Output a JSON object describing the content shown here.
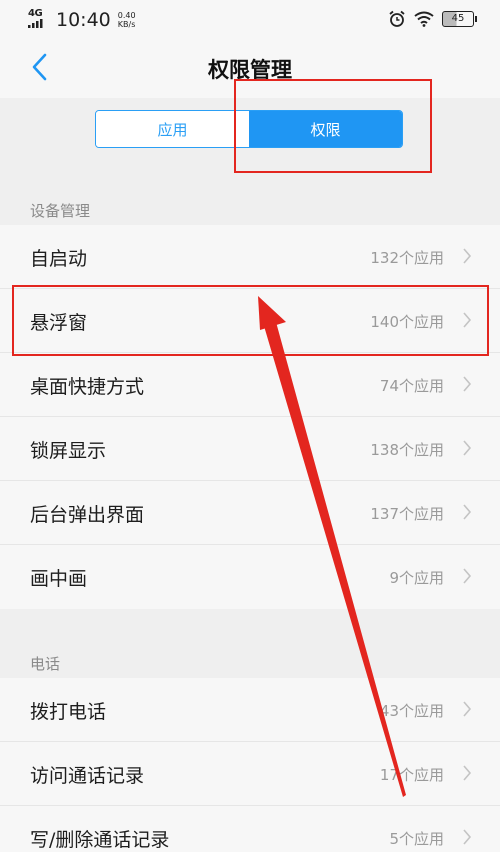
{
  "status": {
    "network": "4G",
    "time": "10:40",
    "speed_value": "0.40",
    "speed_unit": "KB/s",
    "battery": "45"
  },
  "header": {
    "title": "权限管理",
    "back_icon": "chevron-left-icon"
  },
  "tabs": [
    {
      "label": "应用",
      "selected": false
    },
    {
      "label": "权限",
      "selected": true
    }
  ],
  "sections": [
    {
      "title": "设备管理",
      "items": [
        {
          "label": "自启动",
          "value": "132个应用"
        },
        {
          "label": "悬浮窗",
          "value": "140个应用"
        },
        {
          "label": "桌面快捷方式",
          "value": "74个应用"
        },
        {
          "label": "锁屏显示",
          "value": "138个应用"
        },
        {
          "label": "后台弹出界面",
          "value": "137个应用"
        },
        {
          "label": "画中画",
          "value": "9个应用"
        }
      ]
    },
    {
      "title": "电话",
      "items": [
        {
          "label": "拨打电话",
          "value": "43个应用"
        },
        {
          "label": "访问通话记录",
          "value": "17个应用"
        },
        {
          "label": "写/删除通话记录",
          "value": "5个应用"
        }
      ]
    }
  ],
  "colors": {
    "accent": "#1f96f3",
    "annotation": "#e3261f"
  }
}
